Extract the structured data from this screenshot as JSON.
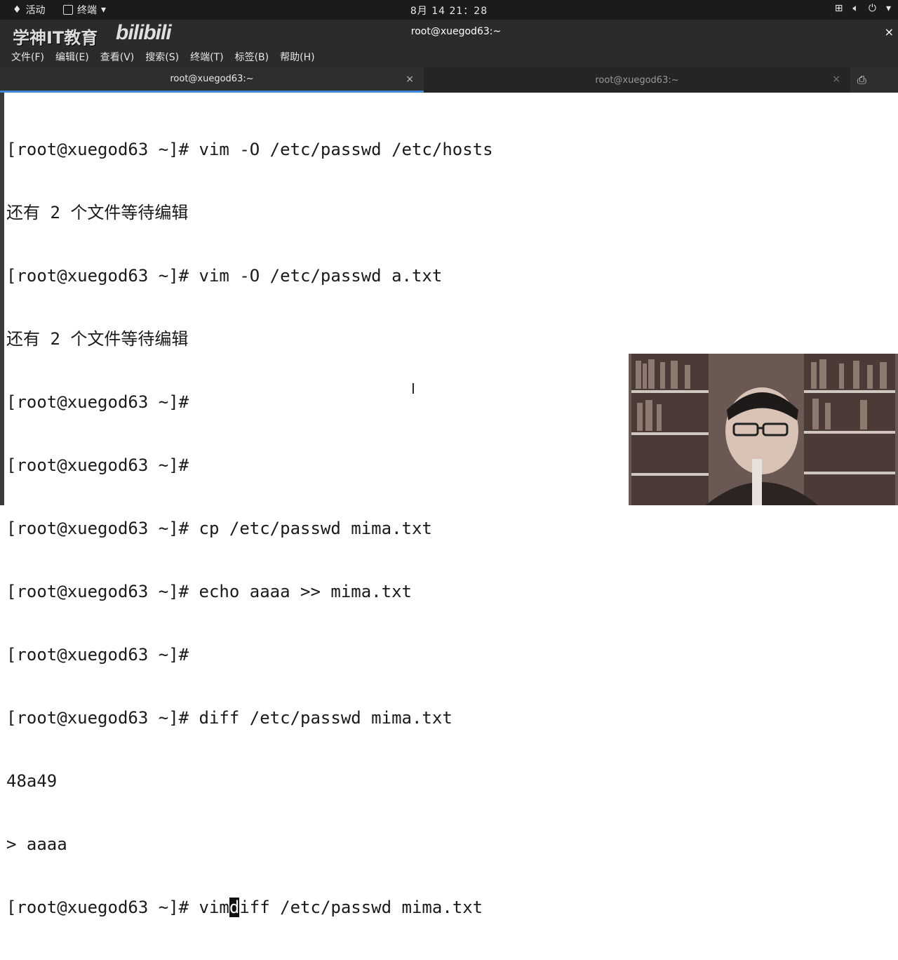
{
  "topbar": {
    "activities": "活动",
    "app_menu": "终端",
    "clock": "8月 14 21：28",
    "tray_icons": [
      "network-icon",
      "volume-icon",
      "power-icon"
    ]
  },
  "window": {
    "brand_text": "学神IT教育",
    "brand_logo": "bilibili",
    "title": "root@xuegod63:~",
    "close": "×"
  },
  "menu": [
    "文件(F)",
    "编辑(E)",
    "查看(V)",
    "搜索(S)",
    "终端(T)",
    "标签(B)",
    "帮助(H)"
  ],
  "tabs": [
    {
      "label": "root@xuegod63:~",
      "active": true
    },
    {
      "label": "root@xuegod63:~",
      "active": false
    }
  ],
  "terminal": {
    "lines": [
      "[root@xuegod63 ~]# vim -O /etc/passwd /etc/hosts",
      "还有 2 个文件等待编辑",
      "[root@xuegod63 ~]# vim -O /etc/passwd a.txt",
      "还有 2 个文件等待编辑",
      "[root@xuegod63 ~]#",
      "[root@xuegod63 ~]#",
      "[root@xuegod63 ~]# cp /etc/passwd mima.txt",
      "[root@xuegod63 ~]# echo aaaa >> mima.txt",
      "[root@xuegod63 ~]#",
      "[root@xuegod63 ~]# diff /etc/passwd mima.txt",
      "48a49",
      "> aaaa"
    ],
    "current_line": {
      "before_cursor": "[root@xuegod63 ~]# vim",
      "cursor_char": "d",
      "after_cursor": "iff /etc/passwd mima.txt"
    }
  },
  "colors": {
    "topbar_bg": "#1b1b1b",
    "titlebar_bg": "#2b2b2b",
    "tab_active_underline": "#3d86d6",
    "terminal_bg": "#ffffff",
    "terminal_fg": "#1a1a1a"
  }
}
